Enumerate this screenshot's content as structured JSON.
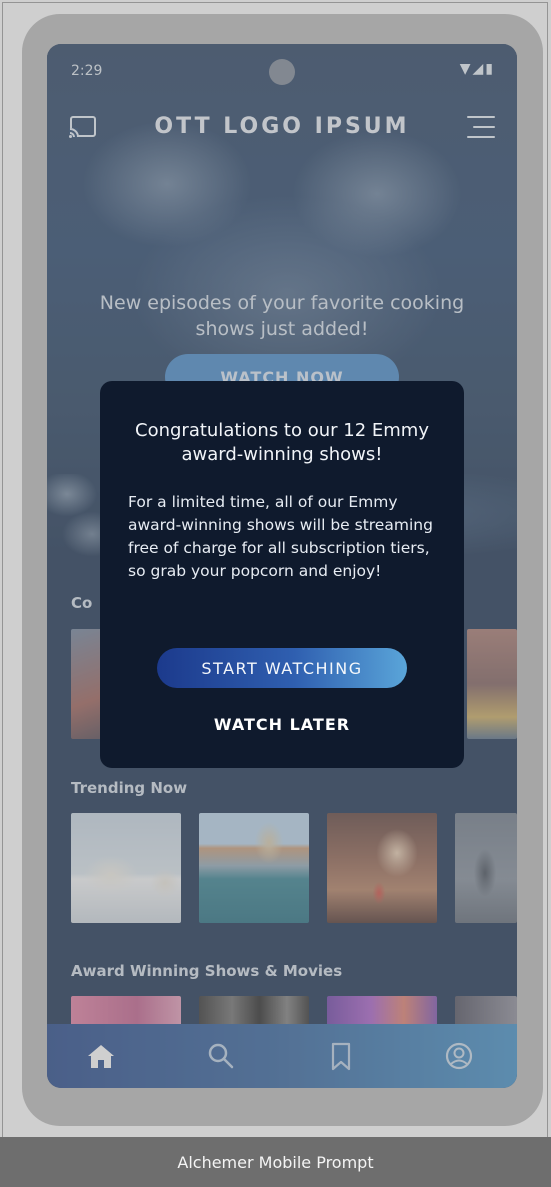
{
  "status_bar": {
    "time": "2:29",
    "icons": "▼◢▮"
  },
  "header": {
    "logo": "OTT LOGO IPSUM",
    "cast_icon": "cast-icon",
    "menu_icon": "menu-icon"
  },
  "hero": {
    "headline": "New episodes of your favorite cooking shows just added!",
    "cta_label": "WATCH NOW"
  },
  "sections": {
    "continue_watching": "Co",
    "trending": "Trending Now",
    "award": "Award Winning Shows & Movies"
  },
  "modal": {
    "title": "Congratulations to our 12 Emmy award-winning shows!",
    "body": "For a limited time, all of our Emmy award-winning shows will be streaming free of charge for all subscription tiers, so grab your popcorn and enjoy!",
    "primary_label": "START WATCHING",
    "secondary_label": "WATCH LATER"
  },
  "bottom_nav": {
    "items": [
      "home-icon",
      "search-icon",
      "bookmark-icon",
      "profile-icon"
    ]
  },
  "footer": {
    "caption": "Alchemer Mobile Prompt"
  },
  "colors": {
    "screen_bg": "#11284a",
    "modal_bg": "#0f1a2d",
    "accent_start": "#1c3a8c",
    "accent_end": "#5aa5d9",
    "device_frame": "#b9b9b9"
  }
}
